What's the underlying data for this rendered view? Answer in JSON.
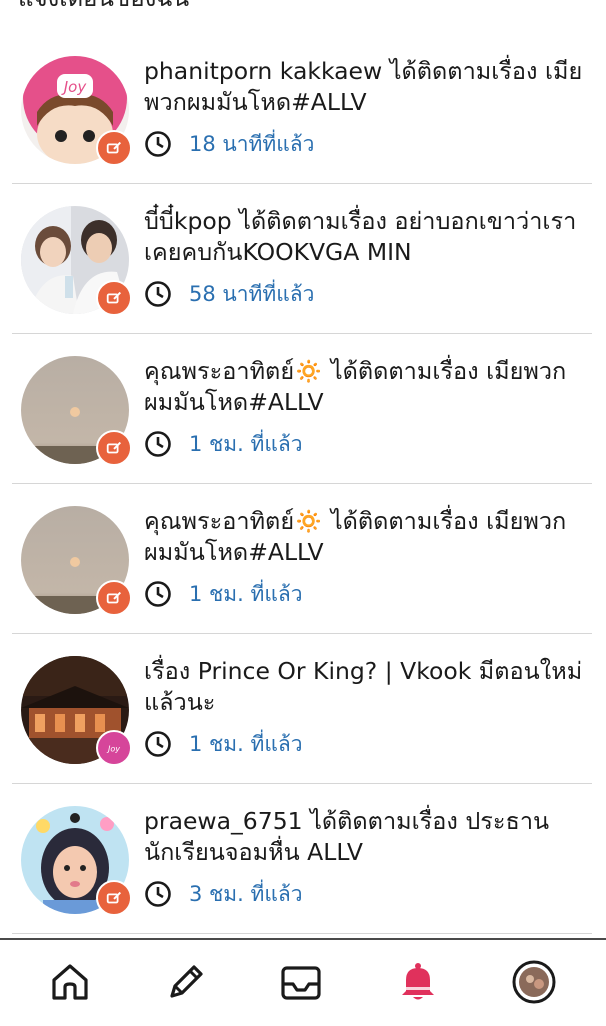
{
  "header": {
    "title_partial": "แจ้งเตือนของฉัน"
  },
  "notifications": [
    {
      "text": "phanitporn kakkaew ได้ติดตามเรื่อง เมียพวกผมมันโหด#ALLV",
      "time": "18 นาทีที่แล้ว",
      "badge": "follow-badge",
      "avatar": "joy-cartoon-avatar"
    },
    {
      "text": "บี๋บี๋kpop ได้ติดตามเรื่อง อย่าบอกเขาว่าเราเคยคบกันKOOKVGA MIN",
      "time": "58 นาทีที่แล้ว",
      "badge": "follow-badge",
      "avatar": "kpop-photo-avatar"
    },
    {
      "text": "คุณพระอาทิตย์🔅 ได้ติดตามเรื่อง เมียพวกผมมันโหด#ALLV",
      "time": "1 ชม. ที่แล้ว",
      "badge": "follow-badge",
      "avatar": "hazy-sun-avatar"
    },
    {
      "text": "คุณพระอาทิตย์🔅 ได้ติดตามเรื่อง เมียพวกผมมันโหด#ALLV",
      "time": "1 ชม. ที่แล้ว",
      "badge": "follow-badge",
      "avatar": "hazy-sun-avatar"
    },
    {
      "text": "เรื่อง Prince Or King? | Vkook มีตอนใหม่แล้วนะ",
      "time": "1 ชม. ที่แล้ว",
      "badge": "joy-badge",
      "avatar": "palace-night-avatar"
    },
    {
      "text": "praewa_6751 ได้ติดตามเรื่อง ประธานนักเรียนจอมหื่น ALLV",
      "time": "3 ชม. ที่แล้ว",
      "badge": "follow-badge",
      "avatar": "girl-selfie-avatar"
    }
  ],
  "nav": {
    "items": [
      "home-icon",
      "pencil-icon",
      "inbox-icon",
      "bell-icon",
      "profile-avatar"
    ],
    "active": "bell-icon",
    "active_color": "#e0315c"
  },
  "colors": {
    "time_text": "#2a6fb0",
    "follow_badge": "#e8623c",
    "joy_badge": "#d6459a"
  }
}
